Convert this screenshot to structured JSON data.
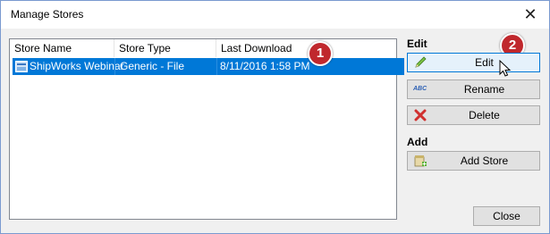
{
  "window": {
    "title": "Manage Stores",
    "close_glyph": "✕"
  },
  "list": {
    "columns": [
      "Store Name",
      "Store Type",
      "Last Download"
    ],
    "rows": [
      {
        "name": "ShipWorks Webinar",
        "type": "Generic - File",
        "last_download": "8/11/2016 1:58 PM",
        "selected": true
      }
    ]
  },
  "annotations": {
    "badge1": "1",
    "badge2": "2"
  },
  "edit_section": {
    "label": "Edit",
    "edit_button": "Edit",
    "rename_button": "Rename",
    "delete_button": "Delete",
    "rename_icon_text": "ABC"
  },
  "add_section": {
    "label": "Add",
    "add_store_button": "Add Store"
  },
  "footer": {
    "close_button": "Close"
  },
  "colors": {
    "selection": "#0078d7",
    "badge": "#c0282d",
    "hover_border": "#0078d7"
  }
}
